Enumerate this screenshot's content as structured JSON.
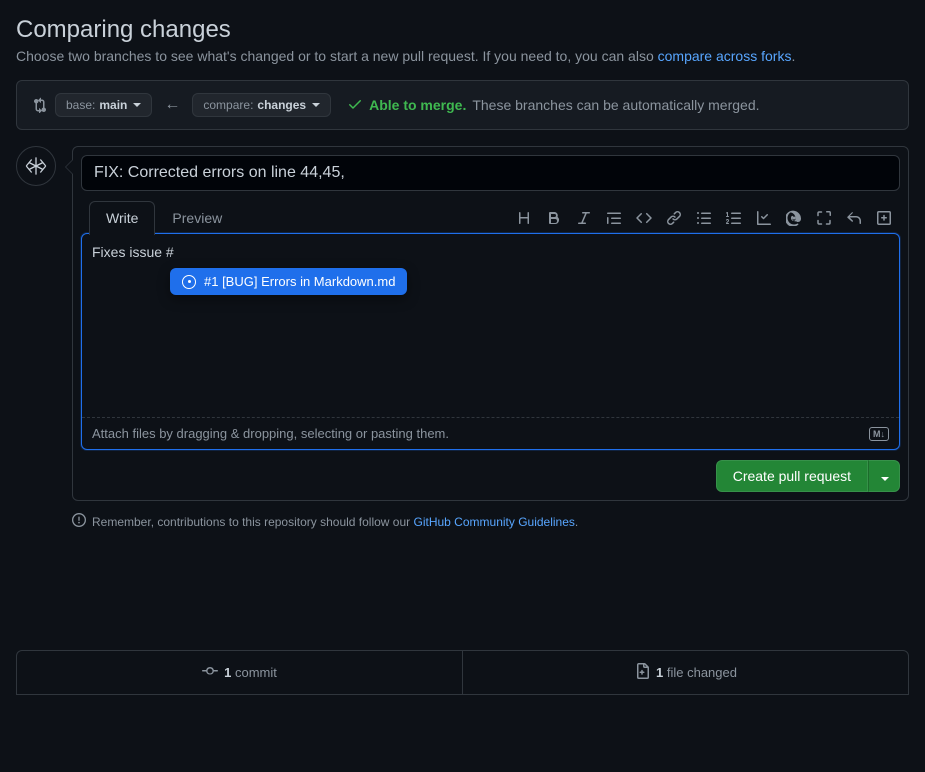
{
  "header": {
    "title": "Comparing changes",
    "subtitle_prefix": "Choose two branches to see what's changed or to start a new pull request. If you need to, you can also ",
    "subtitle_link": "compare across forks",
    "subtitle_suffix": "."
  },
  "compare": {
    "base_label": "base:",
    "base_value": "main",
    "compare_label": "compare:",
    "compare_value": "changes",
    "merge_ok": "Able to merge.",
    "merge_desc": "These branches can be automatically merged."
  },
  "pr": {
    "title_value": "FIX: Corrected errors on line 44,45,",
    "tabs": {
      "write": "Write",
      "preview": "Preview"
    },
    "body_value": "Fixes issue #",
    "attach_text": "Attach files by dragging & dropping, selecting or pasting them.",
    "create_button": "Create pull request",
    "autocomplete": "#1 [BUG] Errors in Markdown.md"
  },
  "footer": {
    "prefix": "Remember, contributions to this repository should follow our ",
    "link": "GitHub Community Guidelines",
    "suffix": "."
  },
  "stats": {
    "commits_count": "1",
    "commits_label": " commit",
    "files_count": "1",
    "files_label": " file changed"
  },
  "icons": {
    "md_badge": "M↓"
  }
}
